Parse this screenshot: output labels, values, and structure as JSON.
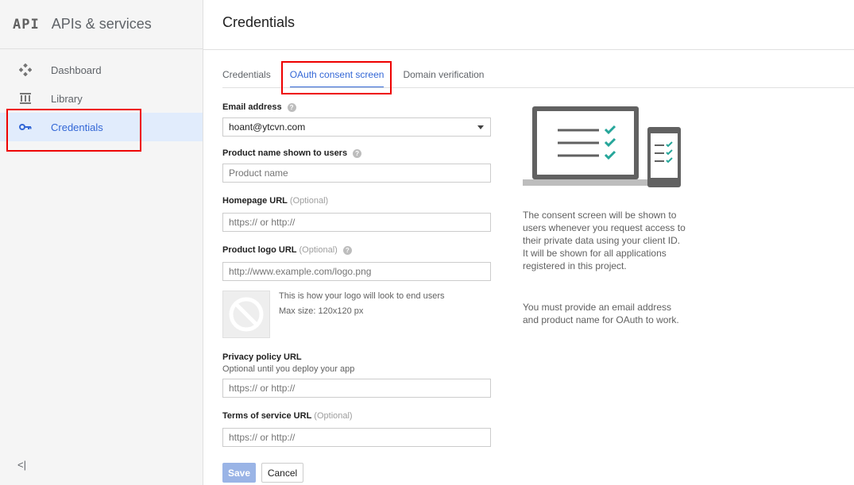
{
  "sidebar": {
    "logo": "API",
    "title": "APIs & services",
    "items": [
      {
        "label": "Dashboard",
        "icon": "dashboard-icon"
      },
      {
        "label": "Library",
        "icon": "library-icon"
      },
      {
        "label": "Credentials",
        "icon": "key-icon",
        "active": true
      }
    ],
    "collapse": "<|"
  },
  "header": {
    "title": "Credentials"
  },
  "tabs": [
    {
      "label": "Credentials"
    },
    {
      "label": "OAuth consent screen",
      "active": true
    },
    {
      "label": "Domain verification"
    }
  ],
  "form": {
    "email": {
      "label": "Email address",
      "value": "hoant@ytcvn.com"
    },
    "product_name": {
      "label": "Product name shown to users",
      "placeholder": "Product name"
    },
    "homepage": {
      "label": "Homepage URL",
      "optional": "(Optional)",
      "placeholder": "https:// or http://"
    },
    "logo_url": {
      "label": "Product logo URL",
      "optional": "(Optional)",
      "placeholder": "http://www.example.com/logo.png"
    },
    "logo_note": "This is how your logo will look to end users",
    "logo_size": "Max size: 120x120 px",
    "privacy": {
      "label": "Privacy policy URL",
      "sub": "Optional until you deploy your app",
      "placeholder": "https:// or http://"
    },
    "terms": {
      "label": "Terms of service URL",
      "optional": "(Optional)",
      "placeholder": "https:// or http://"
    },
    "save_label": "Save",
    "cancel_label": "Cancel"
  },
  "info": {
    "p1": "The consent screen will be shown to users whenever you request access to their private data using your client ID. It will be shown for all applications registered in this project.",
    "p2": "You must provide an email address and product name for OAuth to work."
  },
  "colors": {
    "accent": "#3367d6",
    "highlight": "#e00000",
    "check": "#26a69a"
  }
}
